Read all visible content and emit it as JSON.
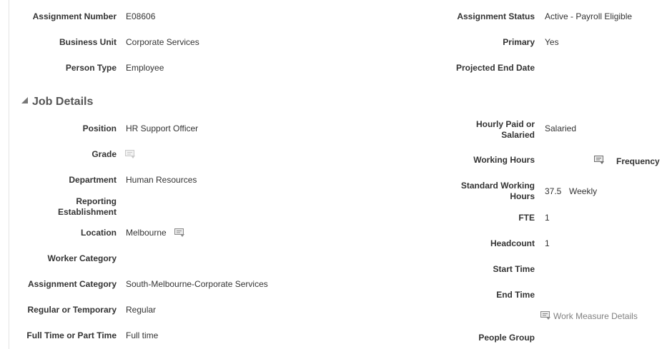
{
  "header": {
    "assignment_number": {
      "label": "Assignment Number",
      "value": "E08606"
    },
    "business_unit": {
      "label": "Business Unit",
      "value": "Corporate Services"
    },
    "person_type": {
      "label": "Person Type",
      "value": "Employee"
    },
    "assignment_status": {
      "label": "Assignment Status",
      "value": "Active - Payroll Eligible"
    },
    "primary": {
      "label": "Primary",
      "value": "Yes"
    },
    "projected_end_date": {
      "label": "Projected End Date",
      "value": ""
    }
  },
  "job_details": {
    "title": "Job Details",
    "left": {
      "position": {
        "label": "Position",
        "value": "HR Support Officer"
      },
      "grade": {
        "label": "Grade",
        "value": "",
        "icon": "details-icon"
      },
      "department": {
        "label": "Department",
        "value": "Human Resources"
      },
      "reporting_establishment": {
        "label_line1": "Reporting",
        "label_line2": "Establishment",
        "value": ""
      },
      "location": {
        "label": "Location",
        "value": "Melbourne",
        "icon": "details-icon"
      },
      "worker_category": {
        "label": "Worker Category",
        "value": ""
      },
      "assignment_category": {
        "label": "Assignment Category",
        "value": "South-Melbourne-Corporate Services"
      },
      "regular_or_temporary": {
        "label": "Regular or Temporary",
        "value": "Regular"
      },
      "full_or_part_time": {
        "label": "Full Time or Part Time",
        "value": "Full time"
      }
    },
    "right": {
      "hourly_paid": {
        "label_line1": "Hourly Paid or",
        "label_line2": "Salaried",
        "value": "Salaried"
      },
      "working_hours": {
        "label": "Working Hours",
        "value": "",
        "frequency_label": "Frequency",
        "icon": "details-icon"
      },
      "standard_working_hours": {
        "label_line1": "Standard Working",
        "label_line2": "Hours",
        "value": "37.5",
        "frequency": "Weekly"
      },
      "fte": {
        "label": "FTE",
        "value": "1"
      },
      "headcount": {
        "label": "Headcount",
        "value": "1"
      },
      "start_time": {
        "label": "Start Time",
        "value": ""
      },
      "end_time": {
        "label": "End Time",
        "value": ""
      },
      "work_measure_link": "Work Measure Details",
      "people_group": {
        "label": "People Group",
        "value": ""
      }
    }
  }
}
